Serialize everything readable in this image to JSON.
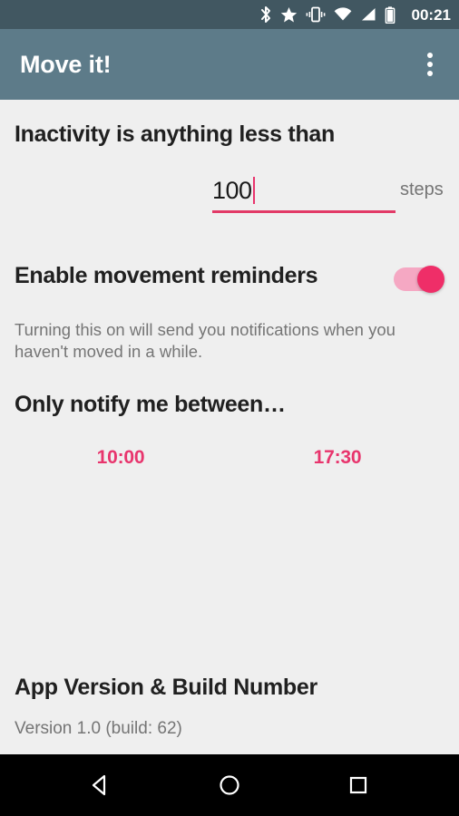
{
  "status_bar": {
    "time": "00:21",
    "icons": [
      {
        "name": "bluetooth-icon"
      },
      {
        "name": "star-icon"
      },
      {
        "name": "vibrate-icon"
      },
      {
        "name": "wifi-icon"
      },
      {
        "name": "cell-signal-icon"
      },
      {
        "name": "battery-icon"
      }
    ],
    "background_color": "#415761",
    "foreground_color": "#ffffff"
  },
  "app_bar": {
    "title": "Move it!",
    "overflow_menu_label": "More options",
    "background_color": "#5d7b89",
    "title_color": "#ffffff"
  },
  "settings": {
    "inactivity": {
      "heading": "Inactivity is anything less than",
      "input_value": "100",
      "input_placeholder": "100",
      "unit_label": "steps",
      "underline_color": "#e23a67",
      "caret_color": "#e8356d"
    },
    "reminders": {
      "heading": "Enable movement reminders",
      "toggle_state": "on",
      "toggle_track_color": "#f5a8c3",
      "toggle_thumb_color": "#ef2e68",
      "description": "Turning this on will send you notifications when you haven't moved in a while."
    },
    "quiet_hours": {
      "heading": "Only notify me between…",
      "start_time": "10:00",
      "end_time": "17:30",
      "time_color": "#e8356d"
    },
    "version": {
      "heading": "App Version & Build Number",
      "value": "Version 1.0 (build: 62)"
    }
  },
  "nav_bar": {
    "background_color": "#000000",
    "buttons": [
      {
        "name": "back-button",
        "label": "Back"
      },
      {
        "name": "home-button",
        "label": "Home"
      },
      {
        "name": "recents-button",
        "label": "Recents"
      }
    ]
  }
}
